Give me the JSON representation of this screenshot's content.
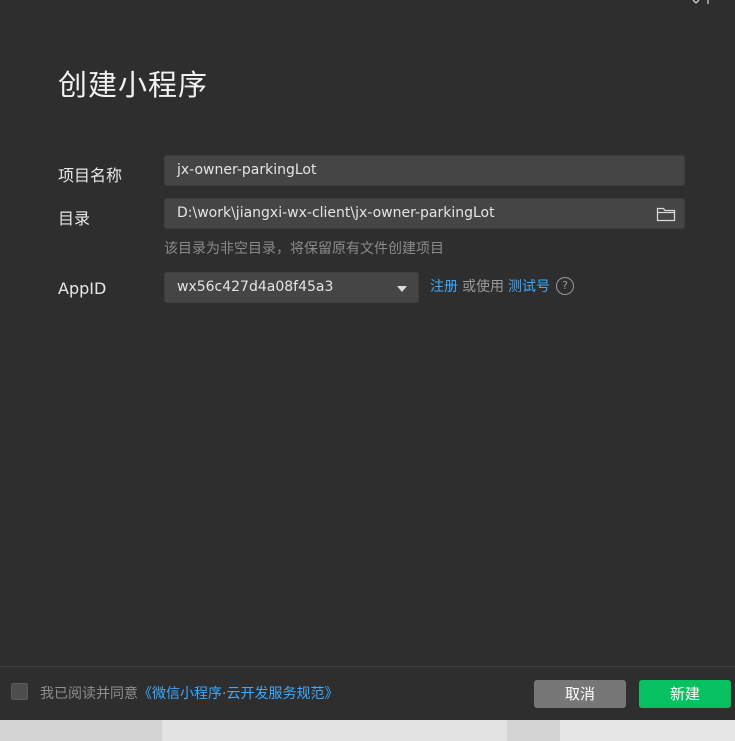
{
  "dialog": {
    "title": "创建小程序",
    "fields": {
      "name_label": "项目名称",
      "name_value": "jx-owner-parkingLot",
      "dir_label": "目录",
      "dir_value": "D:\\work\\jiangxi-wx-client\\jx-owner-parkingLot",
      "dir_hint": "该目录为非空目录，将保留原有文件创建项目",
      "appid_label": "AppID",
      "appid_value": "wx56c427d4a08f45a3",
      "register_link": "注册",
      "or_use_text": "或使用",
      "test_id_link": "测试号",
      "help_glyph": "?"
    },
    "footer": {
      "agree_text": "我已阅读并同意",
      "agreement_link": "《微信小程序·云开发服务规范》",
      "cancel_label": "取消",
      "create_label": "新建"
    },
    "colors": {
      "accent_green": "#07c160",
      "link_blue": "#3ba9ff",
      "background": "#2e2e2e"
    },
    "icons": [
      "folder-icon",
      "chevron-down-icon",
      "help-icon",
      "checkbox"
    ]
  }
}
